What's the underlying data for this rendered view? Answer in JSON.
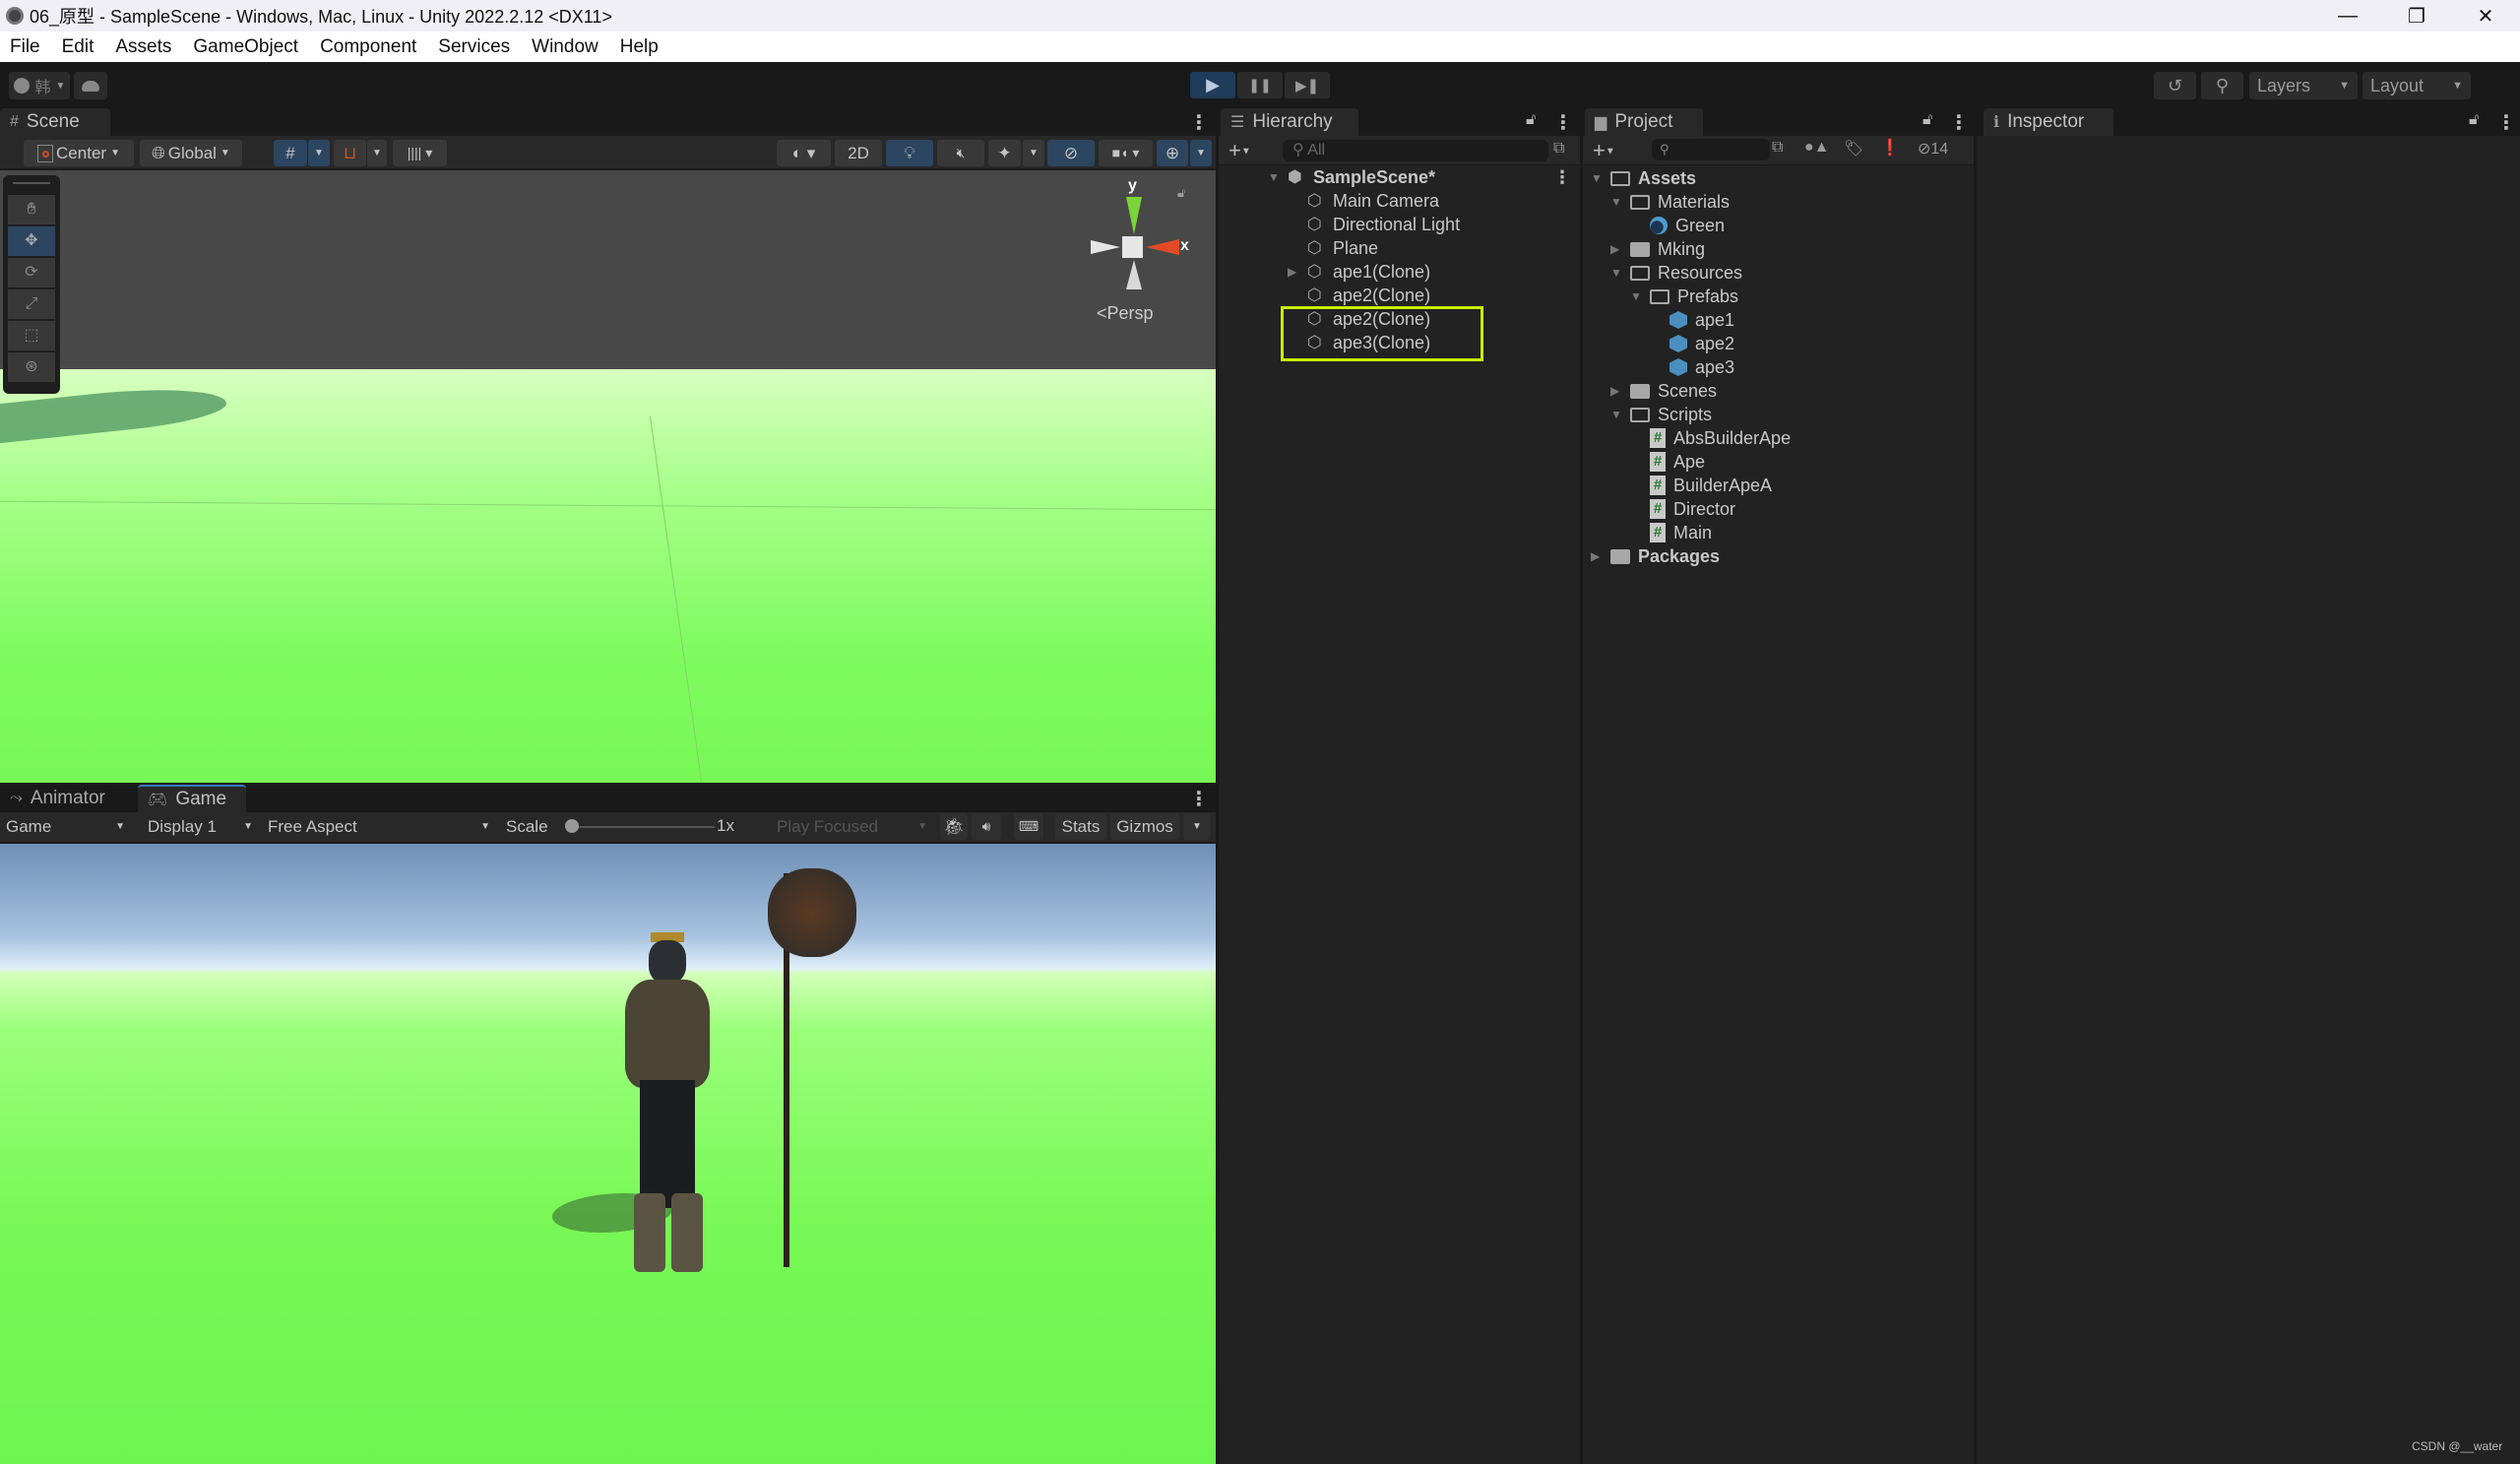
{
  "window": {
    "title": "06_原型 - SampleScene - Windows, Mac, Linux - Unity 2022.2.12 <DX11>",
    "controls": {
      "minimize": "—",
      "restore": "❐",
      "close": "✕"
    }
  },
  "menu": [
    "File",
    "Edit",
    "Assets",
    "GameObject",
    "Component",
    "Services",
    "Window",
    "Help"
  ],
  "toolbar": {
    "account_label": "韩",
    "cloud_icon": "cloud-icon",
    "play": "▶",
    "pause": "❚❚",
    "step": "▶❚",
    "history_icon": "↺",
    "search_icon": "⚲",
    "layers_label": "Layers",
    "layout_label": "Layout"
  },
  "scene": {
    "tab_label": "Scene",
    "pivot_label": "Center",
    "space_label": "Global",
    "mode_2d": "2D",
    "persp_label": "Persp",
    "axis_y": "y",
    "axis_x": "x"
  },
  "game": {
    "tabs": [
      {
        "label": "Animator"
      },
      {
        "label": "Game"
      }
    ],
    "view_select": "Game",
    "display_select": "Display 1",
    "aspect_select": "Free Aspect",
    "scale_label": "Scale",
    "scale_value": "1x",
    "play_focus": "Play Focused",
    "stats_label": "Stats",
    "gizmos_label": "Gizmos"
  },
  "hierarchy": {
    "tab_label": "Hierarchy",
    "search_placeholder": "All",
    "scene_name": "SampleScene*",
    "items": [
      {
        "label": "Main Camera",
        "expandable": false
      },
      {
        "label": "Directional Light",
        "expandable": false
      },
      {
        "label": "Plane",
        "expandable": false
      },
      {
        "label": "ape1(Clone)",
        "expandable": true
      },
      {
        "label": "ape2(Clone)",
        "expandable": false
      },
      {
        "label": "ape2(Clone)",
        "expandable": false,
        "highlighted": true
      },
      {
        "label": "ape3(Clone)",
        "expandable": false,
        "highlighted": true
      }
    ],
    "highlight_color": "#c8f000"
  },
  "project": {
    "tab_label": "Project",
    "hidden_count": "14",
    "tree": [
      {
        "label": "Assets",
        "depth": 0,
        "type": "folder-open",
        "bold": true
      },
      {
        "label": "Materials",
        "depth": 1,
        "type": "folder-open"
      },
      {
        "label": "Green",
        "depth": 2,
        "type": "material"
      },
      {
        "label": "Mking",
        "depth": 1,
        "type": "folder-closed"
      },
      {
        "label": "Resources",
        "depth": 1,
        "type": "folder-open"
      },
      {
        "label": "Prefabs",
        "depth": 2,
        "type": "folder-open"
      },
      {
        "label": "ape1",
        "depth": 3,
        "type": "prefab"
      },
      {
        "label": "ape2",
        "depth": 3,
        "type": "prefab"
      },
      {
        "label": "ape3",
        "depth": 3,
        "type": "prefab"
      },
      {
        "label": "Scenes",
        "depth": 1,
        "type": "folder-closed"
      },
      {
        "label": "Scripts",
        "depth": 1,
        "type": "folder-open"
      },
      {
        "label": "AbsBuilderApe",
        "depth": 2,
        "type": "script"
      },
      {
        "label": "Ape",
        "depth": 2,
        "type": "script"
      },
      {
        "label": "BuilderApeA",
        "depth": 2,
        "type": "script"
      },
      {
        "label": "Director",
        "depth": 2,
        "type": "script"
      },
      {
        "label": "Main",
        "depth": 2,
        "type": "script"
      },
      {
        "label": "Packages",
        "depth": 0,
        "type": "folder-closed",
        "bold": true
      }
    ]
  },
  "inspector": {
    "tab_label": "Inspector"
  },
  "watermark": "CSDN @__water"
}
